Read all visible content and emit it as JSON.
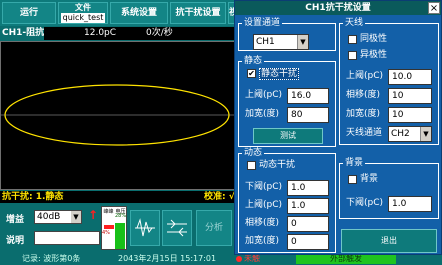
{
  "toolbar": {
    "run": "运行",
    "file_label": "文件",
    "file_value": "quick_test",
    "system": "系统设置",
    "anti_interference": "抗干扰设置",
    "view": "视"
  },
  "channel_bar": {
    "channel": "CH1-阻抗",
    "charge": "12.0pC",
    "rate": "0次/秒"
  },
  "status_line": {
    "left": "抗干扰: 1.静态",
    "right": "校准: √"
  },
  "controls": {
    "gain_label": "增益",
    "gain_value": "40dB",
    "note_label": "说明",
    "note_value": "",
    "arrow": "↑",
    "meter_left": "峰峰",
    "meter_right": "电压",
    "pct_left": "4%",
    "pct_right": "28%",
    "meter_left_level": 0.04,
    "meter_right_level": 0.28,
    "analyze": "分析"
  },
  "footer": {
    "record": "记录: 波形第0条",
    "time": "2043年2月15日 15:17:01",
    "trigger": "未触",
    "external": "外部触发"
  },
  "dialog": {
    "title": "CH1抗干扰设置",
    "close": "×",
    "channel_group": {
      "title": "设置通道",
      "value": "CH1"
    },
    "static_group": {
      "title": "静态",
      "checkbox_label": "静态干扰",
      "checked": true,
      "upper_label": "上阈(pC)",
      "upper_value": "16.0",
      "width_label": "加宽(度)",
      "width_value": "80",
      "test_button": "测试"
    },
    "dynamic_group": {
      "title": "动态",
      "checkbox_label": "动态干扰",
      "checked": false,
      "lower_label": "下阈(pC)",
      "lower_value": "1.0",
      "upper_label": "上阈(pC)",
      "upper_value": "1.0",
      "phase_label": "相移(度)",
      "phase_value": "0",
      "width_label": "加宽(度)",
      "width_value": "0"
    },
    "antenna_group": {
      "title": "天线",
      "same_polarity": "同极性",
      "opposite_polarity": "异极性",
      "upper_label": "上阈(pC)",
      "upper_value": "10.0",
      "phase_label": "相移(度)",
      "phase_value": "10",
      "width_label": "加宽(度)",
      "width_value": "10",
      "channel_label": "天线通道",
      "channel_value": "CH2"
    },
    "background_group": {
      "title": "背景",
      "checkbox_label": "背景",
      "lower_label": "下阈(pC)",
      "lower_value": "1.0"
    },
    "exit_button": "退出"
  },
  "colors": {
    "teal_background": "#0a6d6e",
    "dialog_blue": "#1360a8",
    "trace_yellow": "#ffe300",
    "external_trigger_green": "#1fc41f",
    "alert_red": "#ff2a2a"
  }
}
